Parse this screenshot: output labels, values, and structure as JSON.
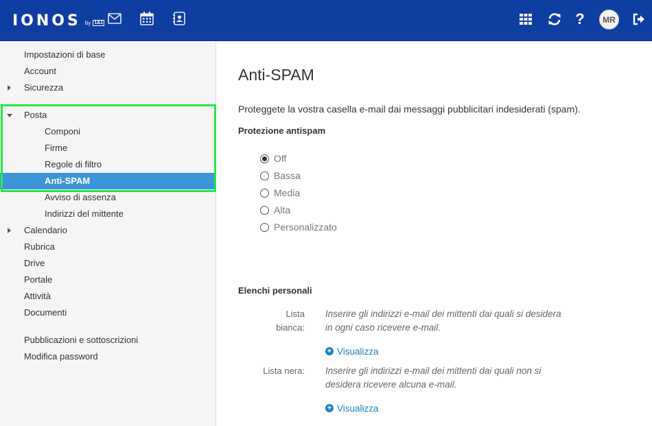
{
  "header": {
    "brand": "IONOS",
    "brand_by": "by",
    "brand_badge": "1&1",
    "user_initials": "MR",
    "icons": [
      "mail-icon",
      "calendar-icon",
      "address-book-icon",
      "apps-grid-icon",
      "refresh-icon",
      "help-icon",
      "logout-icon"
    ],
    "help_label": "?"
  },
  "sidebar": {
    "items": [
      {
        "label": "Impostazioni di base"
      },
      {
        "label": "Account"
      },
      {
        "label": "Sicurezza"
      },
      {
        "label": "Posta"
      },
      {
        "label": "Componi"
      },
      {
        "label": "Firme"
      },
      {
        "label": "Regole di filtro"
      },
      {
        "label": "Anti-SPAM"
      },
      {
        "label": "Avviso di assenza"
      },
      {
        "label": "Indirizzi del mittente"
      },
      {
        "label": "Calendario"
      },
      {
        "label": "Rubrica"
      },
      {
        "label": "Drive"
      },
      {
        "label": "Portale"
      },
      {
        "label": "Attività"
      },
      {
        "label": "Documenti"
      },
      {
        "label": "Pubblicazioni e sottoscrizioni"
      },
      {
        "label": "Modifica password"
      }
    ],
    "active": "Anti-SPAM"
  },
  "main": {
    "title": "Anti-SPAM",
    "intro": "Proteggete la vostra casella e-mail dai messaggi pubblicitari indesiderati (spam).",
    "protection_title": "Protezione antispam",
    "options": [
      {
        "label": "Off",
        "checked": true
      },
      {
        "label": "Bassa",
        "checked": false
      },
      {
        "label": "Media",
        "checked": false
      },
      {
        "label": "Alta",
        "checked": false
      },
      {
        "label": "Personalizzato",
        "checked": false
      }
    ],
    "lists_title": "Elenchi personali",
    "whitelist_label_1": "Lista",
    "whitelist_label_2": "bianca:",
    "whitelist_desc": "Inserire gli indirizzi e-mail dei mittenti dai quali si desidera in ogni caso ricevere e-mail.",
    "blacklist_label": "Lista nera:",
    "blacklist_desc": "Inserire gli indirizzi e-mail dei mittenti dai quali non si desidera ricevere alcuna e-mail.",
    "show_label": "Visualizza"
  },
  "colors": {
    "topbar": "#0f3ea3",
    "active_item": "#3c95d9",
    "highlight": "#26e84a",
    "link": "#1c80c4"
  }
}
